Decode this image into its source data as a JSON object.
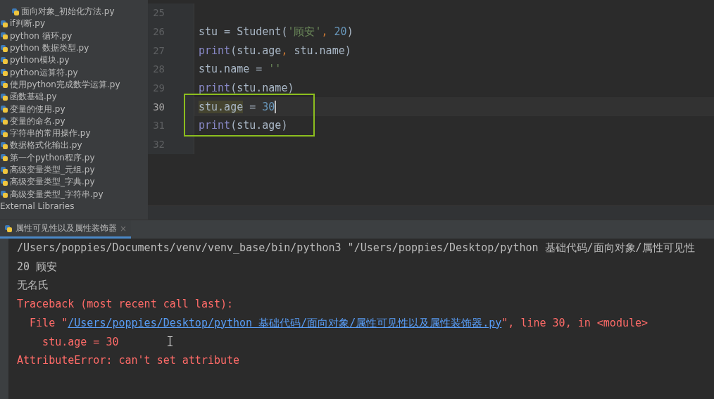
{
  "project_tree": {
    "items": [
      {
        "children": [
          {
            "kind": "file",
            "label": "面向对象_初始化方法.py"
          }
        ]
      },
      {
        "kind": "file",
        "label": "if判断.py"
      },
      {
        "kind": "file",
        "label": "python 循环.py"
      },
      {
        "kind": "file",
        "label": "python 数据类型.py"
      },
      {
        "kind": "file",
        "label": "python模块.py"
      },
      {
        "kind": "file",
        "label": "python运算符.py"
      },
      {
        "kind": "file",
        "label": "使用python完成数学运算.py"
      },
      {
        "kind": "file",
        "label": "函数基础.py"
      },
      {
        "kind": "file",
        "label": "变量的使用.py"
      },
      {
        "kind": "file",
        "label": "变量的命名.py"
      },
      {
        "kind": "file",
        "label": "字符串的常用操作.py"
      },
      {
        "kind": "file",
        "label": "数据格式化输出.py"
      },
      {
        "kind": "file",
        "label": "第一个python程序.py"
      },
      {
        "kind": "file",
        "label": "高级变量类型_元组.py"
      },
      {
        "kind": "file",
        "label": "高级变量类型_字典.py"
      },
      {
        "kind": "file",
        "label": "高级变量类型_字符串.py"
      },
      {
        "kind": "folder",
        "label": "External Libraries"
      }
    ]
  },
  "editor": {
    "lines": [
      {
        "number": "25",
        "current": false,
        "caret": false,
        "boxed": false
      },
      {
        "number": "26",
        "current": false,
        "caret": false,
        "boxed": false,
        "tokens": [
          {
            "kind": "plain",
            "text": "stu = Student("
          },
          {
            "kind": "string",
            "text": "'顾安'"
          },
          {
            "kind": "punct",
            "text": ", "
          },
          {
            "kind": "number",
            "text": "20"
          },
          {
            "kind": "plain",
            "text": ")"
          }
        ]
      },
      {
        "number": "27",
        "current": false,
        "caret": false,
        "boxed": false,
        "tokens": [
          {
            "kind": "builtin",
            "text": "print"
          },
          {
            "kind": "plain",
            "text": "(stu.age"
          },
          {
            "kind": "punct",
            "text": ", "
          },
          {
            "kind": "plain",
            "text": "stu.name)"
          }
        ]
      },
      {
        "number": "28",
        "current": false,
        "caret": false,
        "boxed": false,
        "tokens": [
          {
            "kind": "plain",
            "text": "stu.name = "
          },
          {
            "kind": "string",
            "text": "''"
          }
        ]
      },
      {
        "number": "29",
        "current": false,
        "caret": false,
        "boxed": false,
        "tokens": [
          {
            "kind": "builtin",
            "text": "print"
          },
          {
            "kind": "plain",
            "text": "(stu.name)"
          }
        ]
      },
      {
        "number": "30",
        "current": true,
        "caret": true,
        "boxed": true,
        "tokens": [
          {
            "kind": "marked",
            "text": "stu.age"
          },
          {
            "kind": "plain",
            "text": " = "
          },
          {
            "kind": "number",
            "text": "30"
          }
        ]
      },
      {
        "number": "31",
        "current": false,
        "caret": false,
        "boxed": true,
        "tokens": [
          {
            "kind": "builtin",
            "text": "print"
          },
          {
            "kind": "plain",
            "text": "(stu.age)"
          }
        ]
      },
      {
        "number": "32",
        "current": false,
        "caret": false,
        "boxed": false
      }
    ]
  },
  "run_panel": {
    "tabs": [
      {
        "label": "属性可见性以及属性装饰器",
        "close": "×",
        "selected": true
      }
    ],
    "console": [
      {
        "tokens": [
          {
            "kind": "normal",
            "text": "/Users/poppies/Documents/venv/venv_base/bin/python3 \"/Users/poppies/Desktop/python 基础代码/面向对象/属性可见性"
          }
        ]
      },
      {
        "tokens": [
          {
            "kind": "normal",
            "text": "20 顾安"
          }
        ]
      },
      {
        "tokens": [
          {
            "kind": "normal",
            "text": "无名氏"
          }
        ]
      },
      {
        "tokens": [
          {
            "kind": "error",
            "text": "Traceback (most recent call last):"
          }
        ]
      },
      {
        "tokens": [
          {
            "kind": "error",
            "text": "  File \""
          },
          {
            "kind": "link",
            "text": "/Users/poppies/Desktop/python 基础代码/面向对象/属性可见性以及属性装饰器.py"
          },
          {
            "kind": "error",
            "text": "\", line 30, in <module>"
          }
        ]
      },
      {
        "tokens": [
          {
            "kind": "error",
            "text": "    stu.age = 30"
          }
        ]
      },
      {
        "tokens": [
          {
            "kind": "error",
            "text": "AttributeError: can't set attribute"
          }
        ]
      }
    ]
  }
}
